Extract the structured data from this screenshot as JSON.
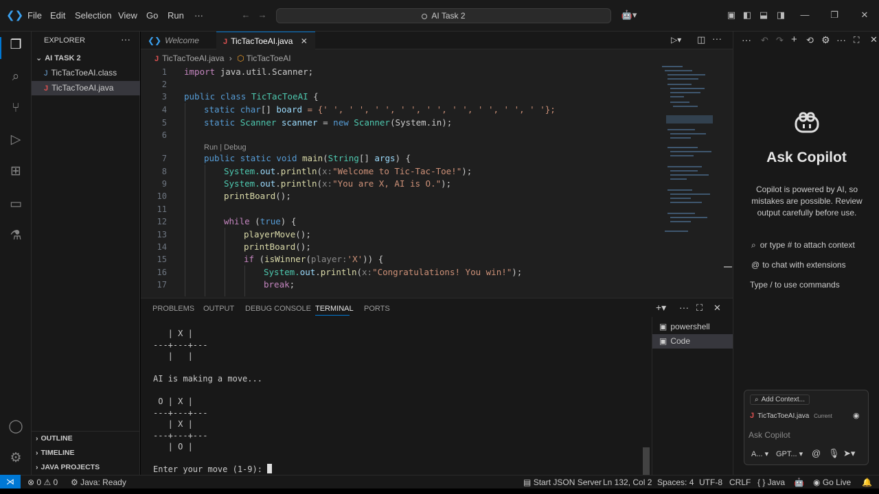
{
  "titlebar": {
    "menu": [
      "File",
      "Edit",
      "Selection",
      "View",
      "Go",
      "Run",
      "···"
    ],
    "search": "AI Task 2"
  },
  "explorer": {
    "title": "EXPLORER",
    "folder": "AI TASK 2",
    "files": [
      "TicTacToeAI.class",
      "TicTacToeAI.java"
    ],
    "sections": [
      "OUTLINE",
      "TIMELINE",
      "JAVA PROJECTS"
    ]
  },
  "tabs": [
    {
      "label": "Welcome"
    },
    {
      "label": "TicTacToeAI.java"
    }
  ],
  "breadcrumb": {
    "file": "TicTacToeAI.java",
    "symbol": "TicTacToeAI"
  },
  "editor": {
    "line_numbers": [
      "1",
      "2",
      "3",
      "4",
      "5",
      "6",
      "7",
      "8",
      "9",
      "10",
      "11",
      "12",
      "13",
      "14",
      "15",
      "16",
      "17"
    ],
    "codelens": "Run | Debug",
    "lines": {
      "l1": [
        "import ",
        "java.util.Scanner;"
      ],
      "l3": [
        "public ",
        "class ",
        "TicTacToeAI",
        " {"
      ],
      "l4": [
        "static ",
        "char",
        "[] ",
        "board",
        " = {' ', ' ', ' ', ' ', ' ', ' ', ' ', ' ', ' '};"
      ],
      "l5": [
        "static ",
        "Scanner ",
        "scanner",
        " = ",
        "new ",
        "Scanner",
        "(System.in);"
      ],
      "l7": [
        "public ",
        "static ",
        "void ",
        "main",
        "(",
        "String",
        "[] ",
        "args",
        ") {"
      ],
      "l8": [
        "System.",
        "out",
        ".",
        "println",
        "(",
        "x:",
        "\"Welcome to Tic-Tac-Toe!\"",
        ");"
      ],
      "l9": [
        "System.",
        "out",
        ".",
        "println",
        "(",
        "x:",
        "\"You are X, AI is O.\"",
        ");"
      ],
      "l10": [
        "printBoard",
        "();"
      ],
      "l12": [
        "while ",
        "(",
        "true",
        ") {"
      ],
      "l13": [
        "playerMove",
        "();"
      ],
      "l14": [
        "printBoard",
        "();"
      ],
      "l15": [
        "if ",
        "(",
        "isWinner",
        "(",
        "player:",
        "'X'",
        ")) {"
      ],
      "l16": [
        "System.",
        "out",
        ".",
        "println",
        "(",
        "x:",
        "\"Congratulations! You win!\"",
        ");"
      ],
      "l17": [
        "break",
        ";"
      ]
    }
  },
  "panel": {
    "tabs": [
      "PROBLEMS",
      "OUTPUT",
      "DEBUG CONSOLE",
      "TERMINAL",
      "PORTS"
    ],
    "active_tab": "TERMINAL",
    "terminal_lines": [
      "   | X |",
      "---+---+---",
      "   |   |",
      "",
      "AI is making a move...",
      "",
      " O | X |",
      "---+---+---",
      "   | X |",
      "---+---+---",
      "   | O |",
      "",
      "Enter your move (1-9): "
    ],
    "terminals": [
      "powershell",
      "Code"
    ]
  },
  "copilot": {
    "title": "Ask Copilot",
    "disclaimer": "Copilot is powered by AI, so mistakes are possible. Review output carefully before use.",
    "hints": [
      "or type # to attach context",
      "to chat with extensions",
      "Type / to use commands"
    ],
    "add_context": "Add Context...",
    "current_file": "TicTacToeAI.java",
    "current_tag": "Current",
    "placeholder": "Ask Copilot",
    "mode": "A...",
    "model": "GPT..."
  },
  "statusbar": {
    "errors": "0",
    "warnings": "0",
    "java_status": "Java: Ready",
    "json_server": "Start JSON Server",
    "position": "Ln 132, Col 2",
    "spaces": "Spaces: 4",
    "encoding": "UTF-8",
    "eol": "CRLF",
    "language": "{ } Java",
    "golive": "Go Live"
  }
}
